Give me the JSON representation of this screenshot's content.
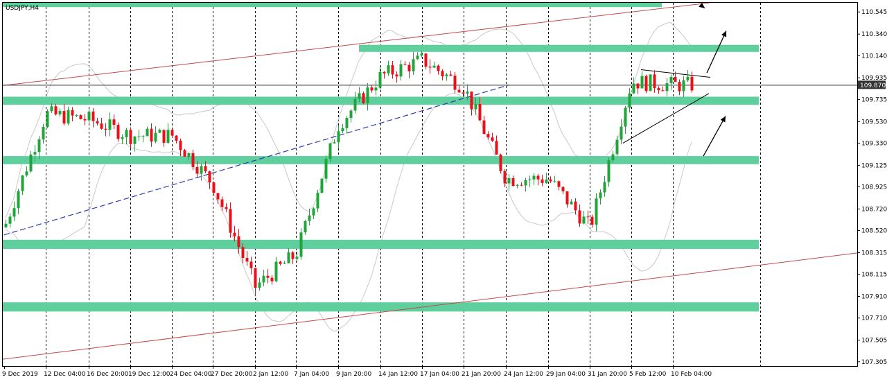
{
  "chart_data": {
    "type": "candlestick",
    "symbol_label": "USDJPY,H4",
    "current_price": 109.87,
    "current_price_label": "109.870",
    "ylim": [
      107.265,
      110.63
    ],
    "y_ticks": [
      "110.545",
      "110.340",
      "110.140",
      "109.935",
      "109.735",
      "109.530",
      "109.330",
      "109.125",
      "108.925",
      "108.720",
      "108.520",
      "108.315",
      "108.115",
      "107.910",
      "107.710",
      "107.505",
      "107.305"
    ],
    "x_labels": [
      "9 Dec 2019",
      "12 Dec 04:00",
      "16 Dec 20:00",
      "19 Dec 12:00",
      "24 Dec 04:00",
      "27 Dec 20:00",
      "2 Jan 12:00",
      "7 Jan 04:00",
      "9 Jan 20:00",
      "14 Jan 12:00",
      "17 Jan 04:00",
      "21 Jan 20:00",
      "24 Jan 12:00",
      "29 Jan 04:00",
      "31 Jan 20:00",
      "5 Feb 12:00",
      "10 Feb 04:00"
    ],
    "grid": "vertical-dashed",
    "colors": {
      "bull": "#1fa53a",
      "bear": "#e8111a",
      "zone": "#5fcf9e",
      "channel": "#c24a4a",
      "trendline": "#2b3bb0",
      "bands": "#c8c8c8",
      "price_line": "#333333",
      "price_tag": "#333333"
    },
    "support_resistance_zones": [
      {
        "from": 110.59,
        "to": 110.64
      },
      {
        "from": 110.175,
        "to": 110.24
      },
      {
        "from": 109.685,
        "to": 109.76
      },
      {
        "from": 109.135,
        "to": 109.21
      },
      {
        "from": 108.35,
        "to": 108.435
      },
      {
        "from": 107.77,
        "to": 107.855
      }
    ],
    "channel_lines": [
      {
        "points": [
          [
            "9 Dec 2019",
            109.865
          ],
          [
            "10 Feb 04:00",
            110.59
          ]
        ]
      },
      {
        "points": [
          [
            "9 Dec 2019",
            107.33
          ],
          [
            "10 Feb 04:00",
            108.1
          ]
        ]
      }
    ],
    "trendline": {
      "points": [
        [
          "9 Dec 2019",
          108.48
        ],
        [
          "24 Jan 12:00",
          109.87
        ]
      ]
    },
    "triangle": {
      "upper": [
        [
          "5 Feb 12:00",
          110.01
        ],
        [
          "10 Feb 04:00",
          109.94
        ]
      ],
      "lower": [
        [
          "5 Feb 12:00",
          109.33
        ],
        [
          "10 Feb 04:00",
          109.79
        ]
      ]
    },
    "arrows": [
      {
        "direction": "up",
        "from": 109.98,
        "to": 110.37
      },
      {
        "direction": "up",
        "from": 109.21,
        "to": 109.58
      },
      {
        "direction": "down",
        "from": 110.6,
        "to": 110.58
      }
    ],
    "key_closes": [
      [
        "9 Dec 2019",
        108.55
      ],
      [
        "12 Dec 04:00",
        109.6
      ],
      [
        "16 Dec 20:00",
        109.55
      ],
      [
        "19 Dec 12:00",
        109.4
      ],
      [
        "24 Dec 04:00",
        109.4
      ],
      [
        "27 Dec 20:00",
        108.95
      ],
      [
        "2 Jan 12:00",
        108.0
      ],
      [
        "7 Jan 04:00",
        108.3
      ],
      [
        "9 Jan 20:00",
        109.5
      ],
      [
        "14 Jan 12:00",
        109.95
      ],
      [
        "17 Jan 04:00",
        110.1
      ],
      [
        "21 Jan 20:00",
        109.85
      ],
      [
        "24 Jan 12:00",
        109.0
      ],
      [
        "29 Jan 04:00",
        109.0
      ],
      [
        "31 Jan 20:00",
        108.55
      ],
      [
        "5 Feb 12:00",
        109.9
      ],
      [
        "10 Feb 04:00",
        109.87
      ]
    ]
  }
}
